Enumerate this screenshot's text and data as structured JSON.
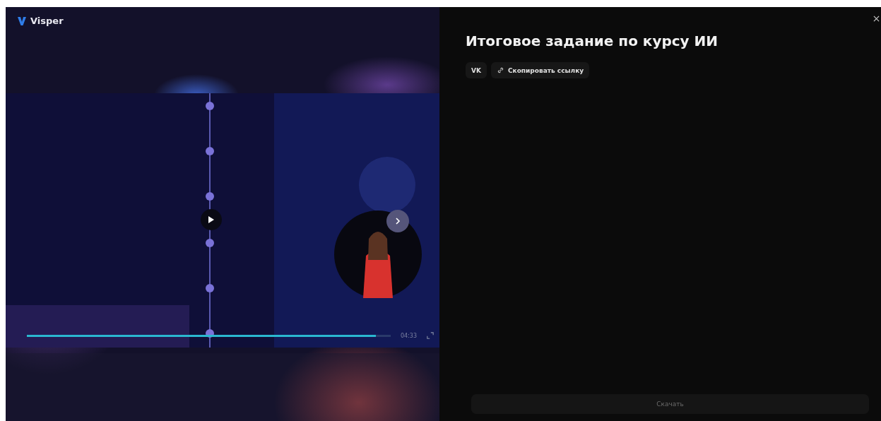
{
  "brand": {
    "name": "Visper"
  },
  "player": {
    "kind": "picture",
    "progress": {
      "level": 0.96
    },
    "time": "04:33"
  },
  "panel": {
    "title": "Итоговое задание по курсу ИИ",
    "share_buttons": [
      {
        "kind": "vk",
        "label": "VK"
      },
      {
        "kind": "link",
        "label": "Скопировать ссылку"
      }
    ],
    "download_button": {
      "label": "Скачать",
      "disabled": true
    }
  }
}
